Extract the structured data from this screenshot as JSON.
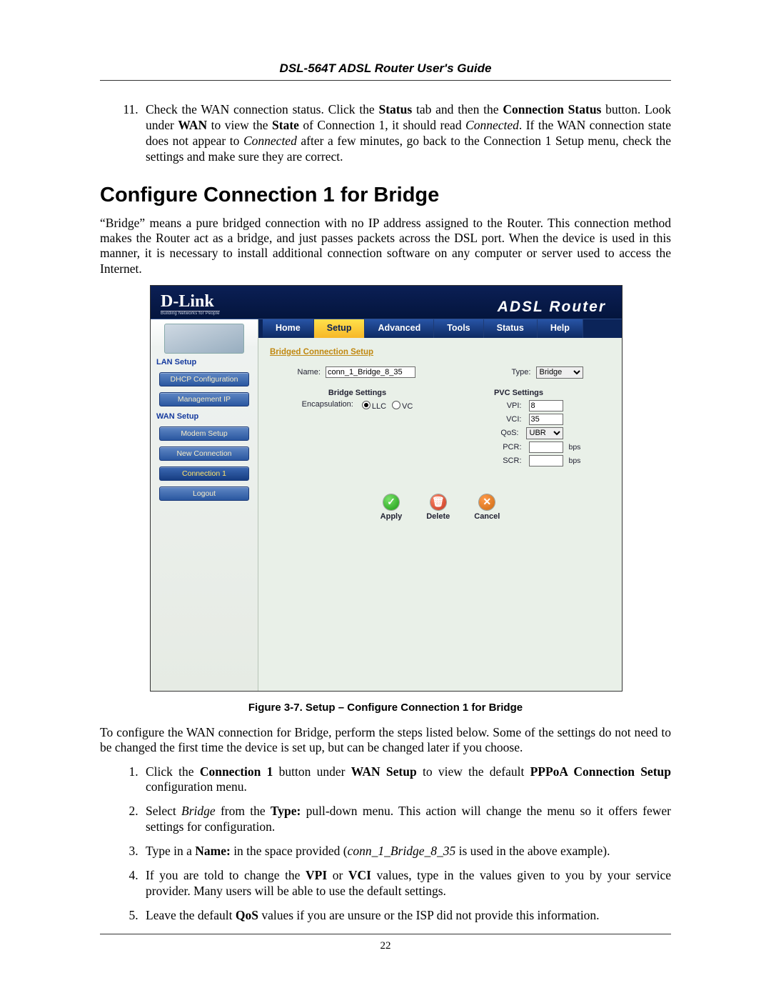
{
  "doc": {
    "header": "DSL-564T ADSL Router User's Guide",
    "page_number": "22",
    "section_heading": "Configure Connection 1 for Bridge",
    "step11_html": "Check the WAN connection status. Click the <b>Status</b> tab and then the <b>Connection Status</b> button. Look under <b>WAN</b> to view the <b>State</b> of Connection 1, it should read <i>Connected</i>. If the WAN connection state does not appear to <i>Connected</i> after a few minutes, go back to the Connection 1 Setup menu, check the settings and make sure they are correct.",
    "intro": "“Bridge” means a pure bridged connection with no IP address assigned to the Router. This connection method makes the Router act as a bridge, and just passes packets across the DSL port. When the device is used in this manner, it is necessary to install additional connection software on any computer or server used to access the Internet.",
    "figure_caption": "Figure 3-7. Setup – Configure Connection 1 for Bridge",
    "after_figure": "To configure the WAN connection for Bridge, perform the steps listed below. Some of the settings do not need to be changed the first time the device is set up, but can be changed later if you choose.",
    "steps": [
      "Click the <b>Connection 1</b> button under <b>WAN Setup</b> to view the default <b>PPPoA Connection Setup</b> configuration menu.",
      "Select <i>Bridge</i> from the <b>Type:</b> pull-down menu. This action will change the menu so it offers fewer settings for configuration.",
      "Type in a <b>Name:</b> in the space provided (<i>conn_1_Bridge_8_35</i> is used in the above example).",
      "If you are told to change the <b>VPI</b> or <b>VCI</b> values, type in the values given to you by your service provider. Many users will be able to use the default settings.",
      "Leave the default <b>QoS</b> values if you are unsure or the ISP did not provide this information."
    ]
  },
  "router": {
    "brand": "D-Link",
    "brand_sub": "Building Networks for People",
    "product": "ADSL Router",
    "tabs": [
      "Home",
      "Setup",
      "Advanced",
      "Tools",
      "Status",
      "Help"
    ],
    "active_tab_index": 1,
    "sidebar": {
      "lan_label": "LAN Setup",
      "wan_label": "WAN Setup",
      "items_lan": [
        "DHCP Configuration",
        "Management IP"
      ],
      "items_wan": [
        "Modem Setup",
        "New Connection",
        "Connection 1",
        "Logout"
      ],
      "selected_item": "Connection 1"
    },
    "panel": {
      "title": "Bridged Connection Setup",
      "name_label": "Name:",
      "name_value": "conn_1_Bridge_8_35",
      "type_label": "Type:",
      "type_value": "Bridge",
      "bridge_heading": "Bridge Settings",
      "encaps_label": "Encapsulation:",
      "enc_llc": "LLC",
      "enc_vc": "VC",
      "enc_selected": "LLC",
      "pvc_heading": "PVC Settings",
      "vpi_label": "VPI:",
      "vpi_value": "8",
      "vci_label": "VCI:",
      "vci_value": "35",
      "qos_label": "QoS:",
      "qos_value": "UBR",
      "pcr_label": "PCR:",
      "pcr_value": "",
      "scr_label": "SCR:",
      "scr_value": "",
      "unit": "bps",
      "apply": "Apply",
      "delete": "Delete",
      "cancel": "Cancel"
    }
  }
}
